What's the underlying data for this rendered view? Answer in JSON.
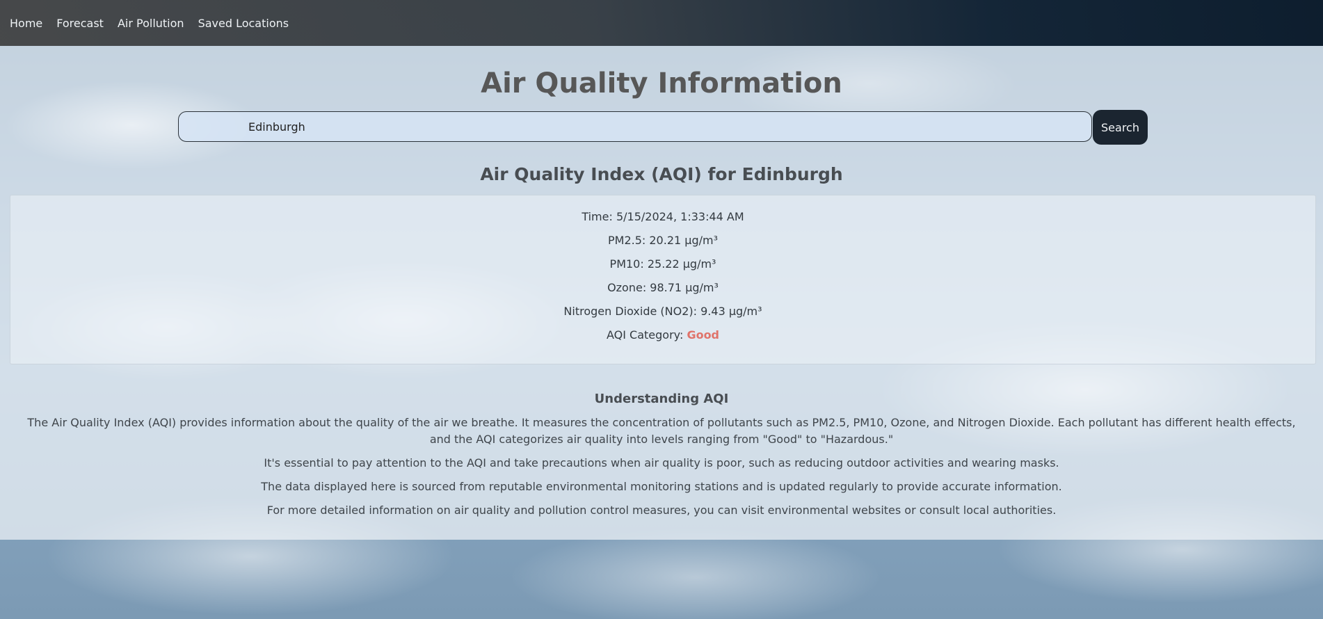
{
  "nav": {
    "items": [
      {
        "label": "Home"
      },
      {
        "label": "Forecast"
      },
      {
        "label": "Air Pollution"
      },
      {
        "label": "Saved Locations"
      }
    ]
  },
  "page": {
    "title": "Air Quality Information"
  },
  "search": {
    "value": "Edinburgh",
    "button_label": "Search"
  },
  "aqi": {
    "heading": "Air Quality Index (AQI) for Edinburgh",
    "time": "Time: 5/15/2024, 1:33:44 AM",
    "pm25": "PM2.5: 20.21 µg/m³",
    "pm10": "PM10: 25.22 µg/m³",
    "ozone": "Ozone: 98.71 µg/m³",
    "no2": "Nitrogen Dioxide (NO2): 9.43 µg/m³",
    "category_label": "AQI Category: ",
    "category_value": "Good",
    "category_color": "#e0736a"
  },
  "understanding": {
    "title": "Understanding AQI",
    "paragraphs": [
      "The Air Quality Index (AQI) provides information about the quality of the air we breathe. It measures the concentration of pollutants such as PM2.5, PM10, Ozone, and Nitrogen Dioxide. Each pollutant has different health effects, and the AQI categorizes air quality into levels ranging from \"Good\" to \"Hazardous.\"",
      "It's essential to pay attention to the AQI and take precautions when air quality is poor, such as reducing outdoor activities and wearing masks.",
      "The data displayed here is sourced from reputable environmental monitoring stations and is updated regularly to provide accurate information.",
      "For more detailed information on air quality and pollution control measures, you can visit environmental websites or consult local authorities."
    ]
  }
}
